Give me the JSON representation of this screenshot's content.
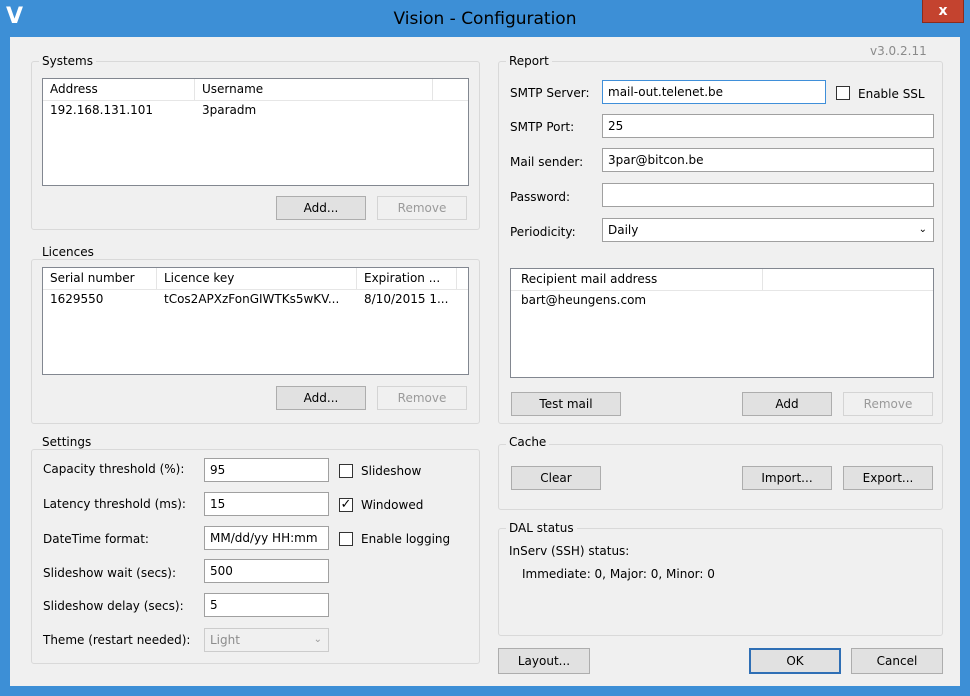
{
  "window": {
    "title": "Vision - Configuration",
    "icon": "V",
    "close_glyph": "x",
    "version": "v3.0.2.11"
  },
  "systems": {
    "label": "Systems",
    "columns": [
      "Address",
      "Username"
    ],
    "rows": [
      [
        "192.168.131.101",
        "3paradm"
      ]
    ],
    "add_label": "Add...",
    "remove_label": "Remove"
  },
  "licences": {
    "label": "Licences",
    "columns": [
      "Serial number",
      "Licence key",
      "Expiration ..."
    ],
    "rows": [
      [
        "1629550",
        "tCos2APXzFonGIWTKs5wKV...",
        "8/10/2015 1..."
      ]
    ],
    "add_label": "Add...",
    "remove_label": "Remove"
  },
  "settings": {
    "label": "Settings",
    "capacity_label": "Capacity threshold (%):",
    "capacity_value": "95",
    "latency_label": "Latency threshold (ms):",
    "latency_value": "15",
    "datetime_label": "DateTime format:",
    "datetime_value": "MM/dd/yy HH:mm",
    "wait_label": "Slideshow wait (secs):",
    "wait_value": "500",
    "delay_label": "Slideshow delay (secs):",
    "delay_value": "5",
    "theme_label": "Theme (restart needed):",
    "theme_value": "Light",
    "slideshow_label": "Slideshow",
    "slideshow_checked": false,
    "windowed_label": "Windowed",
    "windowed_checked": true,
    "logging_label": "Enable logging",
    "logging_checked": false
  },
  "report": {
    "label": "Report",
    "smtp_server_label": "SMTP Server:",
    "smtp_server_value": "mail-out.telenet.be",
    "ssl_label": "Enable SSL",
    "ssl_checked": false,
    "smtp_port_label": "SMTP Port:",
    "smtp_port_value": "25",
    "sender_label": "Mail sender:",
    "sender_value": "3par@bitcon.be",
    "password_label": "Password:",
    "password_value": "",
    "periodicity_label": "Periodicity:",
    "periodicity_value": "Daily",
    "recipients_column": "Recipient mail address",
    "recipients": [
      "bart@heungens.com"
    ],
    "test_label": "Test mail",
    "add_label": "Add",
    "remove_label": "Remove"
  },
  "cache": {
    "label": "Cache",
    "clear_label": "Clear",
    "import_label": "Import...",
    "export_label": "Export..."
  },
  "dal": {
    "label": "DAL status",
    "line1": "InServ (SSH) status:",
    "line2": "Immediate: 0, Major: 0, Minor: 0"
  },
  "footer": {
    "layout_label": "Layout...",
    "ok_label": "OK",
    "cancel_label": "Cancel"
  },
  "colors": {
    "accent": "#3d8fd6",
    "close": "#c4432f",
    "focus_border": "#3f8fd9"
  }
}
